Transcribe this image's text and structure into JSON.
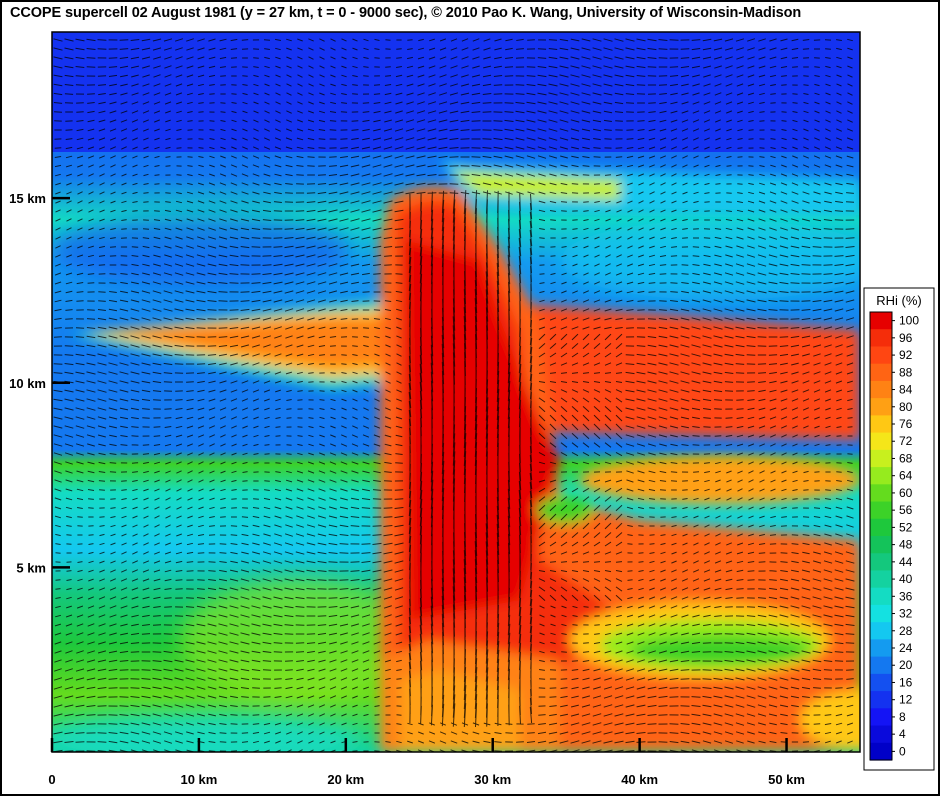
{
  "title": "CCOPE supercell 02 August 1981  (y = 27 km,  t = 0 - 9000 sec),  © 2010 Pao K. Wang, University of Wisconsin-Madison",
  "chart_data": {
    "type": "heatmap",
    "x_ticks": [
      {
        "value": 0,
        "label": "0"
      },
      {
        "value": 10,
        "label": "10 km"
      },
      {
        "value": 20,
        "label": "20 km"
      },
      {
        "value": 30,
        "label": "30 km"
      },
      {
        "value": 40,
        "label": "40 km"
      },
      {
        "value": 50,
        "label": "50 km"
      }
    ],
    "y_ticks": [
      {
        "value": 5,
        "label": "5 km"
      },
      {
        "value": 10,
        "label": "10 km"
      },
      {
        "value": 15,
        "label": "15 km"
      }
    ],
    "xlim": [
      0,
      55
    ],
    "ylim": [
      0,
      19.5
    ],
    "colorbar": {
      "title": "RHi (%)",
      "labels": [
        "100",
        "96",
        "92",
        "88",
        "84",
        "80",
        "76",
        "72",
        "68",
        "64",
        "60",
        "56",
        "52",
        "48",
        "44",
        "40",
        "36",
        "32",
        "28",
        "24",
        "20",
        "16",
        "12",
        "8",
        "4",
        "0"
      ],
      "colors": [
        "#e60000",
        "#f52d0a",
        "#ff4612",
        "#ff6414",
        "#ff8214",
        "#ffa014",
        "#ffc814",
        "#f5e619",
        "#c8f01e",
        "#96eb1e",
        "#64dc1e",
        "#3cd228",
        "#1ec83c",
        "#14c35a",
        "#14c87d",
        "#14d2a0",
        "#14dcc3",
        "#14e1e1",
        "#14c8f0",
        "#149bf0",
        "#1478f0",
        "#1450f0",
        "#1432f0",
        "#1414f5",
        "#0a0adc",
        "#0000c8"
      ]
    }
  }
}
